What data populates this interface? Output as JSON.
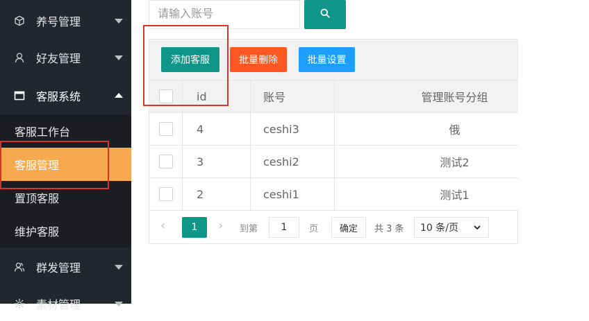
{
  "sidebar": {
    "nav": [
      {
        "label": "养号管理",
        "icon": "cube-icon",
        "expanded": false
      },
      {
        "label": "好友管理",
        "icon": "user-icon",
        "expanded": false
      },
      {
        "label": "客服系统",
        "icon": "window-icon",
        "expanded": true
      },
      {
        "label": "群发管理",
        "icon": "users-icon",
        "expanded": false
      },
      {
        "label": "素材管理",
        "icon": "gear-icon",
        "expanded": false
      }
    ],
    "sub_items": [
      {
        "label": "客服工作台",
        "active": false
      },
      {
        "label": "客服管理",
        "active": true
      },
      {
        "label": "置顶客服",
        "active": false
      },
      {
        "label": "维护客服",
        "active": false
      }
    ]
  },
  "search": {
    "placeholder": "请输入账号",
    "button_icon": "search-icon"
  },
  "toolbar": {
    "add_label": "添加客服",
    "delete_label": "批量删除",
    "settings_label": "批量设置"
  },
  "table": {
    "headers": [
      "id",
      "账号",
      "管理账号分组"
    ],
    "rows": [
      {
        "id": "4",
        "account": "ceshi3",
        "group": "俄"
      },
      {
        "id": "3",
        "account": "ceshi2",
        "group": "测试2"
      },
      {
        "id": "2",
        "account": "ceshi1",
        "group": "测试1"
      }
    ]
  },
  "pager": {
    "current_page": "1",
    "goto_label": "到第",
    "goto_value": "1",
    "page_label": "页",
    "confirm_label": "确定",
    "total_label": "共 3 条",
    "page_size_label": "10 条/页"
  },
  "colors": {
    "sidebar_bg": "#23262e",
    "accent_teal": "#0f9688",
    "active_orange": "#f6a94e",
    "danger": "#ff5722",
    "info": "#1e9fff",
    "annotation_red": "#d9342b"
  }
}
